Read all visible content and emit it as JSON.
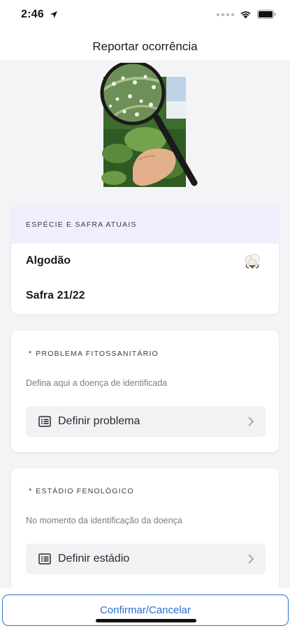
{
  "status_bar": {
    "time": "2:46"
  },
  "nav": {
    "title": "Reportar ocorrência"
  },
  "species_card": {
    "header": "ESPÉCIE E SAFRA ATUAIS",
    "species": "Algodão",
    "safra": "Safra 21/22"
  },
  "problem_card": {
    "required_mark": "*",
    "title": "PROBLEMA FITOSSANITÁRIO",
    "description": "Defina aqui a doença de identificada",
    "button_label": "Definir problema"
  },
  "stage_card": {
    "required_mark": "*",
    "title": "ESTÁDIO FENOLÓGICO",
    "description": "No momento da identificação da doença",
    "button_label": "Definir estádio"
  },
  "footer": {
    "confirm_label": "Confirmar/Cancelar"
  },
  "colors": {
    "accent": "#2c6fd1",
    "header_bg": "#eeeefc",
    "page_bg": "#f4f4f6"
  },
  "icons": [
    "location-arrow-icon",
    "wifi-icon",
    "battery-icon",
    "cotton-icon",
    "list-icon",
    "chevron-right-icon"
  ]
}
